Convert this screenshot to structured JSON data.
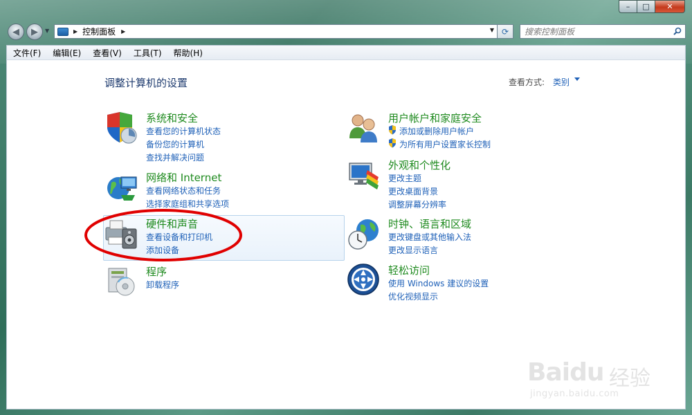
{
  "window": {
    "caption_buttons": {
      "minimize": "–",
      "maximize": "□",
      "close": "✕"
    }
  },
  "nav": {
    "address_path": "控制面板",
    "search_placeholder": "搜索控制面板"
  },
  "menu": [
    "文件(F)",
    "编辑(E)",
    "查看(V)",
    "工具(T)",
    "帮助(H)"
  ],
  "main": {
    "title": "调整计算机的设置",
    "view_by_label": "查看方式:",
    "view_by_value": "类别"
  },
  "categories": [
    {
      "id": "system-security",
      "icon": "shield-icon",
      "title": "系统和安全",
      "links": [
        "查看您的计算机状态",
        "备份您的计算机",
        "查找并解决问题"
      ]
    },
    {
      "id": "network-internet",
      "icon": "globe-network-icon",
      "title": "网络和 Internet",
      "links": [
        "查看网络状态和任务",
        "选择家庭组和共享选项"
      ]
    },
    {
      "id": "hardware-sound",
      "icon": "printer-speaker-icon",
      "title": "硬件和声音",
      "links": [
        "查看设备和打印机",
        "添加设备"
      ]
    },
    {
      "id": "programs",
      "icon": "programs-icon",
      "title": "程序",
      "links": [
        "卸载程序"
      ]
    },
    {
      "id": "user-accounts",
      "icon": "users-icon",
      "title": "用户帐户和家庭安全",
      "links": [
        "添加或删除用户帐户",
        "为所有用户设置家长控制"
      ]
    },
    {
      "id": "appearance",
      "icon": "monitor-palette-icon",
      "title": "外观和个性化",
      "links": [
        "更改主题",
        "更改桌面背景",
        "调整屏幕分辨率"
      ]
    },
    {
      "id": "clock-language",
      "icon": "clock-globe-icon",
      "title": "时钟、语言和区域",
      "links": [
        "更改键盘或其他输入法",
        "更改显示语言"
      ]
    },
    {
      "id": "ease-of-access",
      "icon": "ease-of-access-icon",
      "title": "轻松访问",
      "links": [
        "使用 Windows 建议的设置",
        "优化视频显示"
      ]
    }
  ],
  "watermark": {
    "brand": "Baidu",
    "suffix": "经验",
    "url": "jingyan.baidu.com"
  },
  "colors": {
    "link": "#1f61b8",
    "category_title": "#1e8a1e",
    "annotation": "#e00000"
  }
}
